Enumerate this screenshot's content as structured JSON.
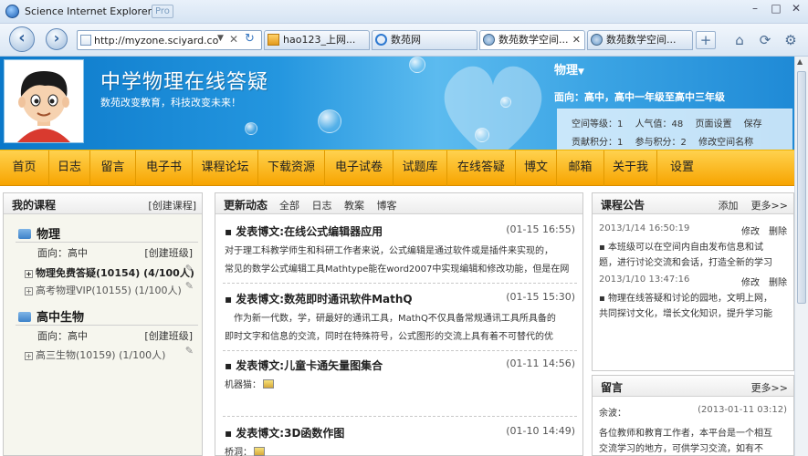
{
  "window": {
    "title": "Science Internet Explorer",
    "badge": "Pro",
    "controls": [
      "–",
      "□",
      "✕"
    ]
  },
  "navbar": {
    "back_icon": "back-arrow-icon",
    "forward_icon": "forward-arrow-icon",
    "address": "http://myzone.sciyard.com",
    "tabs": [
      {
        "label": "hao123_上网...",
        "active": false,
        "closable": false
      },
      {
        "label": "数苑网",
        "active": false,
        "closable": false
      },
      {
        "label": "数苑数学空间...",
        "active": true,
        "closable": true
      },
      {
        "label": "数苑数学空间...",
        "active": false,
        "closable": false
      }
    ],
    "new_tab": "+",
    "tools": [
      "home-icon",
      "refresh-icon",
      "settings-icon"
    ]
  },
  "header": {
    "site_title": "中学物理在线答疑",
    "slogan": "数苑改变教育，科技改变未来！",
    "subject": "物理",
    "level": "面向：高中，高中一年级至高中三年级",
    "stats": {
      "space_level": "空间等级：1",
      "popularity": "人气值：48",
      "page_settings": "页面设置",
      "save": "保存",
      "contribution": "贡献积分：1",
      "participation": "参与积分：2",
      "rename": "修改空间名称"
    }
  },
  "menu": [
    "首页",
    "日志",
    "留言",
    "电子书",
    "课程论坛",
    "下载资源",
    "电子试卷",
    "试题库",
    "在线答疑",
    "博文",
    "邮箱",
    "关于我",
    "设置"
  ],
  "courses": {
    "title": "我的课程",
    "create_course": "[创建课程]",
    "groups": [
      {
        "name": "物理",
        "audience": "面向：高中",
        "create_class": "[创建班级]",
        "items": [
          {
            "label": "物理免费答疑(10154) (4/100人)",
            "bold": true
          },
          {
            "label": "高考物理VIP(10155) (1/100人)",
            "bold": false
          }
        ]
      },
      {
        "name": "高中生物",
        "audience": "面向：高中",
        "create_class": "[创建班级]",
        "items": [
          {
            "label": "高三生物(10159) (1/100人)",
            "bold": false
          }
        ]
      }
    ]
  },
  "updates": {
    "title": "更新动态",
    "filters": [
      "全部",
      "日志",
      "教案",
      "博客"
    ],
    "posts": [
      {
        "title": "▪ 发表博文:在线公式编辑器应用",
        "date": "(01-15 16:55)",
        "lines": [
          "对于理工科教学师生和科研工作者来说，公式编辑是通过软件或是插件来实现的，",
          "常见的数学公式编辑工具Mathtype能在word2007中实现编辑和修改功能，但是在网"
        ]
      },
      {
        "title": "▪ 发表博文:数苑即时通讯软件MathQ",
        "date": "(01-15 15:30)",
        "lines": [
          "　作为新一代数，学，研最好的通讯工具，MathQ不仅具备常规通讯工具所具备的",
          "即时文字和信息的交流，同时在特殊符号，公式图形的交流上具有着不可替代的优"
        ]
      },
      {
        "title": "▪ 发表博文:儿童卡通矢量图集合",
        "date": "(01-11 14:56)",
        "lines": [
          "机器猫："
        ],
        "image": true
      },
      {
        "title": "▪ 发表博文:3D函数作图",
        "date": "(01-10 14:49)",
        "lines": [
          "桥洞："
        ],
        "image": true
      }
    ]
  },
  "announcements": {
    "title": "课程公告",
    "add": "添加",
    "more": "更多>>",
    "items": [
      {
        "date": "2013/1/14 16:50:19",
        "edit": "修改",
        "delete": "删除",
        "lines": [
          "▪ 本班级可以在空间内自由发布信息和试",
          "题，进行讨论交流和会话，打造全新的学习"
        ]
      },
      {
        "date": "2013/1/10 13:47:16",
        "edit": "修改",
        "delete": "删除",
        "lines": [
          "▪ 物理在线答疑和讨论的园地，文明上网，",
          "共同探讨文化，增长文化知识，提升学习能"
        ]
      }
    ]
  },
  "messages": {
    "title": "留言",
    "more": "更多>>",
    "items": [
      {
        "author": "余波：",
        "date": "(2013-01-11 03:12)",
        "lines": [
          "各位教师和教育工作者，本平台是一个相互",
          "交流学习的地方，可供学习交流，如有不"
        ]
      }
    ]
  }
}
